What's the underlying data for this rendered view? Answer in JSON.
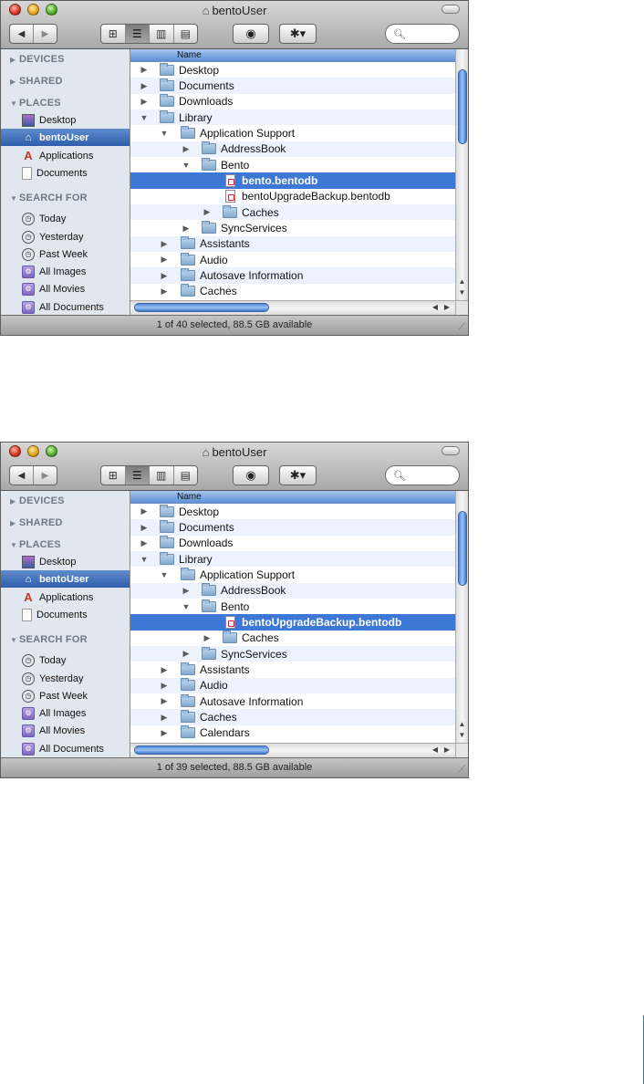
{
  "windows": [
    {
      "title": "bentoUser",
      "toolbar": {
        "nav_back": "◀",
        "nav_forward": "▶",
        "quicklook": "◉",
        "action": "✱▾",
        "search_placeholder": ""
      },
      "sidebar": {
        "devices": "DEVICES",
        "shared": "SHARED",
        "places": "PLACES",
        "search_for": "SEARCH FOR",
        "place_items": [
          "Desktop",
          "bentoUser",
          "Applications",
          "Documents"
        ],
        "search_items": [
          "Today",
          "Yesterday",
          "Past Week",
          "All Images",
          "All Movies",
          "All Documents"
        ]
      },
      "column_header": "Name",
      "rows": [
        {
          "name": "Desktop"
        },
        {
          "name": "Documents"
        },
        {
          "name": "Downloads"
        },
        {
          "name": "Library"
        },
        {
          "name": "Application Support"
        },
        {
          "name": "AddressBook"
        },
        {
          "name": "Bento"
        },
        {
          "name": "bento.bentodb"
        },
        {
          "name": "bentoUpgradeBackup.bentodb"
        },
        {
          "name": "Caches"
        },
        {
          "name": "SyncServices"
        },
        {
          "name": "Assistants"
        },
        {
          "name": "Audio"
        },
        {
          "name": "Autosave Information"
        },
        {
          "name": "Caches"
        }
      ],
      "status": "1 of 40 selected, 88.5 GB available"
    },
    {
      "title": "bentoUser",
      "toolbar": {
        "nav_back": "◀",
        "nav_forward": "▶",
        "quicklook": "◉",
        "action": "✱▾",
        "search_placeholder": ""
      },
      "sidebar": {
        "devices": "DEVICES",
        "shared": "SHARED",
        "places": "PLACES",
        "search_for": "SEARCH FOR",
        "place_items": [
          "Desktop",
          "bentoUser",
          "Applications",
          "Documents"
        ],
        "search_items": [
          "Today",
          "Yesterday",
          "Past Week",
          "All Images",
          "All Movies",
          "All Documents"
        ]
      },
      "column_header": "Name",
      "rows": [
        {
          "name": "Desktop"
        },
        {
          "name": "Documents"
        },
        {
          "name": "Downloads"
        },
        {
          "name": "Library"
        },
        {
          "name": "Application Support"
        },
        {
          "name": "AddressBook"
        },
        {
          "name": "Bento"
        },
        {
          "name": "bentoUpgradeBackup.bentodb"
        },
        {
          "name": "Caches"
        },
        {
          "name": "SyncServices"
        },
        {
          "name": "Assistants"
        },
        {
          "name": "Audio"
        },
        {
          "name": "Autosave Information"
        },
        {
          "name": "Caches"
        },
        {
          "name": "Calendars"
        }
      ],
      "status": "1 of 39 selected, 88.5 GB available"
    }
  ]
}
